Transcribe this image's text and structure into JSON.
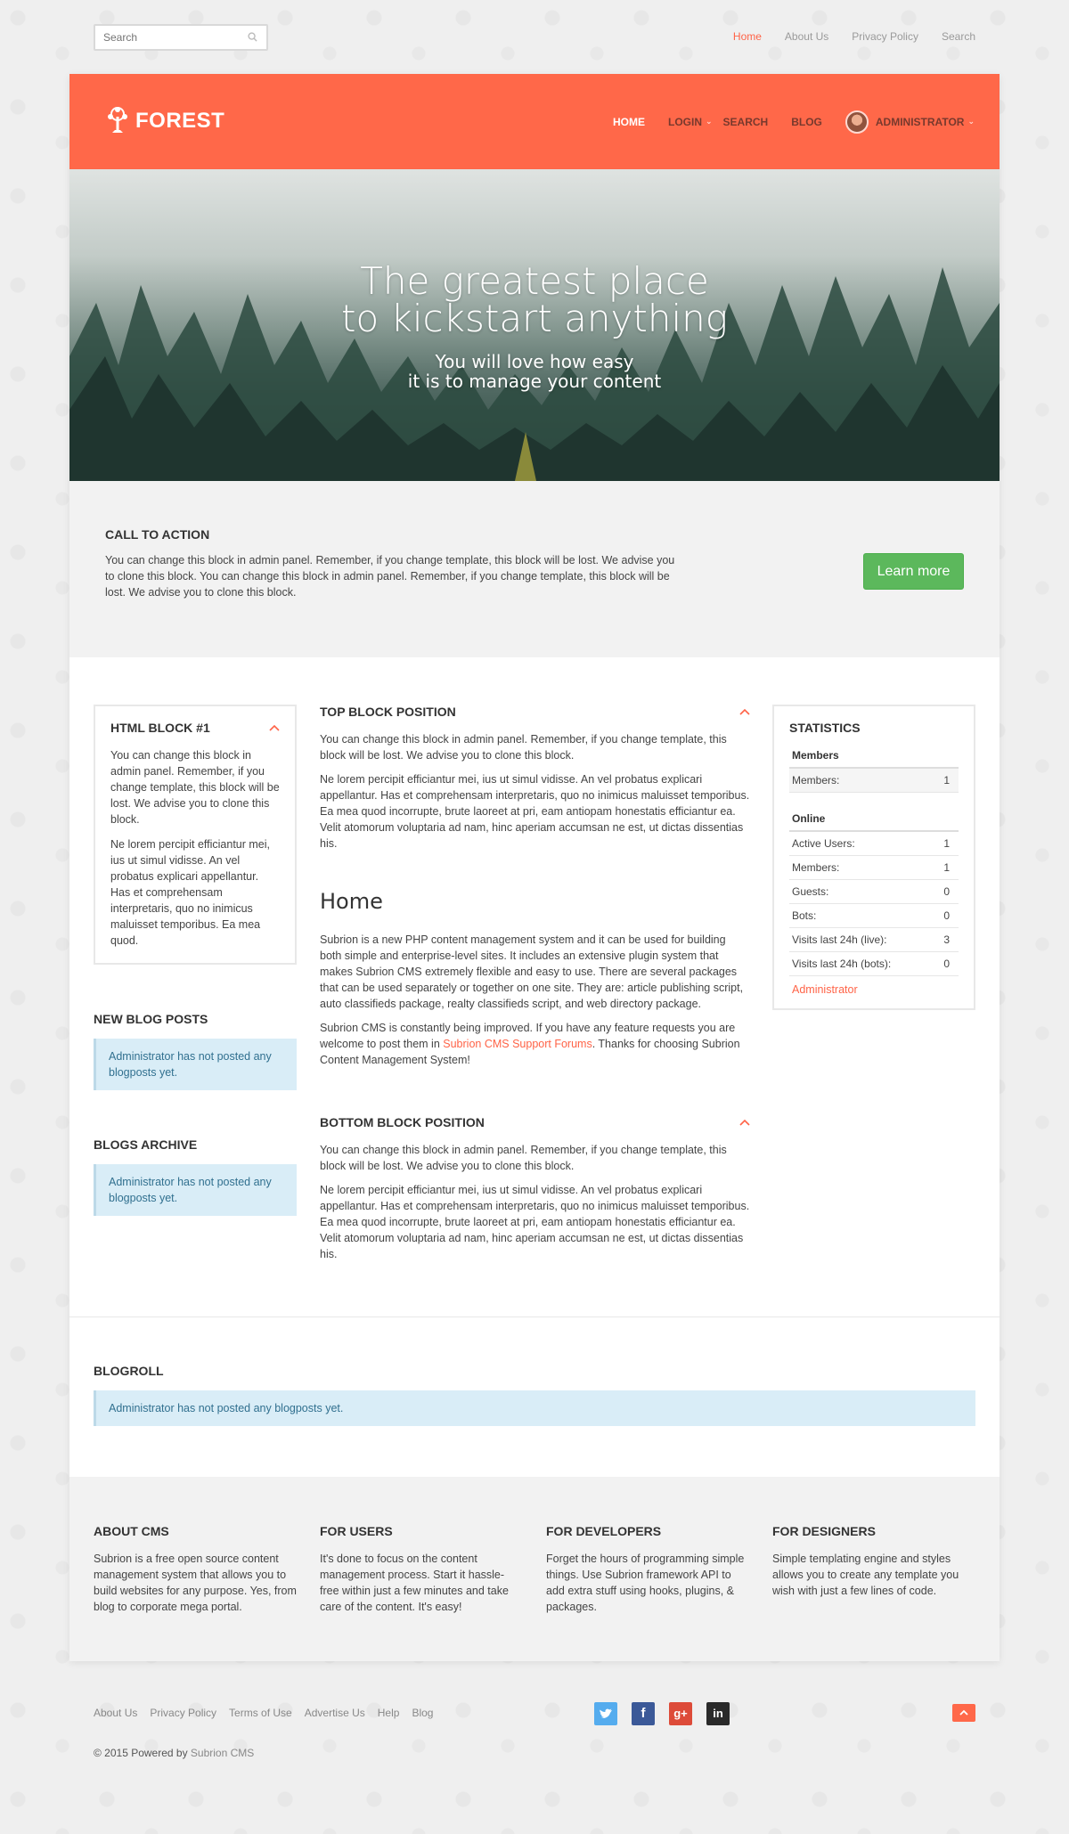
{
  "topbar": {
    "search_placeholder": "Search",
    "links": [
      "Home",
      "About Us",
      "Privacy Policy",
      "Search"
    ]
  },
  "header": {
    "logo": "FOREST",
    "nav": [
      "HOME",
      "LOGIN",
      "SEARCH",
      "BLOG",
      "ADMINISTRATOR"
    ]
  },
  "hero": {
    "title": "The greatest place\nto kickstart anything",
    "subtitle": "You will love how easy\nit is to manage your content"
  },
  "cta": {
    "title": "CALL TO ACTION",
    "text": "You can change this block in admin panel. Remember, if you change template, this block will be lost. We advise you to clone this block. You can change this block in admin panel. Remember, if you change template, this block will be lost. We advise you to clone this block.",
    "button": "Learn more"
  },
  "html_block": {
    "title": "HTML BLOCK #1",
    "p1": "You can change this block in admin panel. Remember, if you change template, this block will be lost. We advise you to clone this block.",
    "p2": "Ne lorem percipit efficiantur mei, ius ut simul vidisse. An vel probatus explicari appellantur. Has et comprehensam interpretaris, quo no inimicus maluisset temporibus. Ea mea quod."
  },
  "new_blog_posts": {
    "title": "NEW BLOG POSTS",
    "message": "Administrator has not posted any blogposts yet."
  },
  "blogs_archive": {
    "title": "BLOGS ARCHIVE",
    "message": "Administrator has not posted any blogposts yet."
  },
  "top_block": {
    "title": "TOP BLOCK POSITION",
    "p1": "You can change this block in admin panel. Remember, if you change template, this block will be lost. We advise you to clone this block.",
    "p2": "Ne lorem percipit efficiantur mei, ius ut simul vidisse. An vel probatus explicari appellantur. Has et comprehensam interpretaris, quo no inimicus maluisset temporibus. Ea mea quod incorrupte, brute laoreet at pri, eam antiopam honestatis efficiantur ea. Velit atomorum voluptaria ad nam, hinc aperiam accumsan ne est, ut dictas dissentias his."
  },
  "home": {
    "title": "Home",
    "p1": "Subrion is a new PHP content management system and it can be used for building both simple and enterprise-level sites. It includes an extensive plugin system that makes Subrion CMS extremely flexible and easy to use. There are several packages that can be used separately or together on one site. They are: article publishing script, auto classifieds package, realty classifieds script, and web directory package.",
    "p2_before": "Subrion CMS is constantly being improved. If you have any feature requests you are welcome to post them in ",
    "p2_link": "Subrion CMS Support Forums",
    "p2_after": ". Thanks for choosing Subrion Content Management System!"
  },
  "bottom_block": {
    "title": "BOTTOM BLOCK POSITION",
    "p1": "You can change this block in admin panel. Remember, if you change template, this block will be lost. We advise you to clone this block.",
    "p2": "Ne lorem percipit efficiantur mei, ius ut simul vidisse. An vel probatus explicari appellantur. Has et comprehensam interpretaris, quo no inimicus maluisset temporibus. Ea mea quod incorrupte, brute laoreet at pri, eam antiopam honestatis efficiantur ea. Velit atomorum voluptaria ad nam, hinc aperiam accumsan ne est, ut dictas dissentias his."
  },
  "statistics": {
    "title": "STATISTICS",
    "members_header": "Members",
    "members": [
      {
        "label": "Members:",
        "value": "1"
      }
    ],
    "online_header": "Online",
    "online": [
      {
        "label": "Active Users:",
        "value": "1"
      },
      {
        "label": "Members:",
        "value": "1"
      },
      {
        "label": "Guests:",
        "value": "0"
      },
      {
        "label": "Bots:",
        "value": "0"
      },
      {
        "label": "Visits last 24h (live):",
        "value": "3"
      },
      {
        "label": "Visits last 24h (bots):",
        "value": "0"
      }
    ],
    "admin_link": "Administrator"
  },
  "blogroll": {
    "title": "BLOGROLL",
    "message": "Administrator has not posted any blogposts yet."
  },
  "footer": {
    "columns": [
      {
        "title": "ABOUT CMS",
        "text": "Subrion is a free open source content management system that allows you to build websites for any purpose. Yes, from blog to corporate mega portal."
      },
      {
        "title": "FOR USERS",
        "text": "It's done to focus on the content management process. Start it hassle-free within just a few minutes and take care of the content. It's easy!"
      },
      {
        "title": "FOR DEVELOPERS",
        "text": "Forget the hours of programming simple things. Use Subrion framework API to add extra stuff using hooks, plugins, & packages."
      },
      {
        "title": "FOR DESIGNERS",
        "text": "Simple templating engine and styles allows you to create any template you wish with just a few lines of code."
      }
    ],
    "links": [
      "About Us",
      "Privacy Policy",
      "Terms of Use",
      "Advertise Us",
      "Help",
      "Blog"
    ],
    "social_icons": [
      "twitter-icon",
      "facebook-icon",
      "google-plus-icon",
      "linkedin-icon"
    ],
    "copyright_prefix": "© 2015 Powered by ",
    "copyright_link": "Subrion CMS"
  },
  "colors": {
    "accent": "#ff6849",
    "button_green": "#5cb85c",
    "info_bg": "#d9edf7"
  }
}
